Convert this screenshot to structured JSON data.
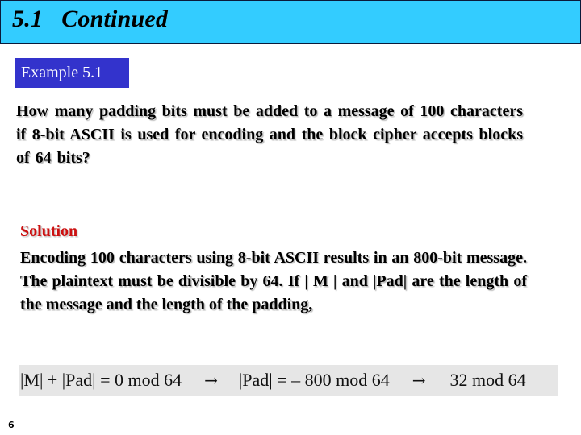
{
  "header": {
    "title": "5.1   Continued"
  },
  "example": {
    "label": "Example 5.1"
  },
  "question": {
    "text": "How many padding bits must be added to a message of 100 characters if 8-bit ASCII is used for encoding and the block cipher accepts blocks of 64 bits?"
  },
  "solution": {
    "heading": "Solution",
    "body": "Encoding 100 characters using 8-bit ASCII results in an 800-bit message. The plaintext must be divisible by 64. If | M | and |Pad| are the length of the message and the length of the padding,"
  },
  "equation": {
    "part1": "|M| + |Pad| = 0 mod 64",
    "arrow1": "→",
    "part2": "|Pad| = – 800 mod 64",
    "arrow2": "→",
    "part3": "32 mod 64"
  },
  "footer": {
    "page_number": "6"
  },
  "colors": {
    "title_bar": "#33ccff",
    "example_badge": "#3333cc",
    "solution_heading": "#cc1111",
    "equation_background": "#e6e6e6"
  }
}
